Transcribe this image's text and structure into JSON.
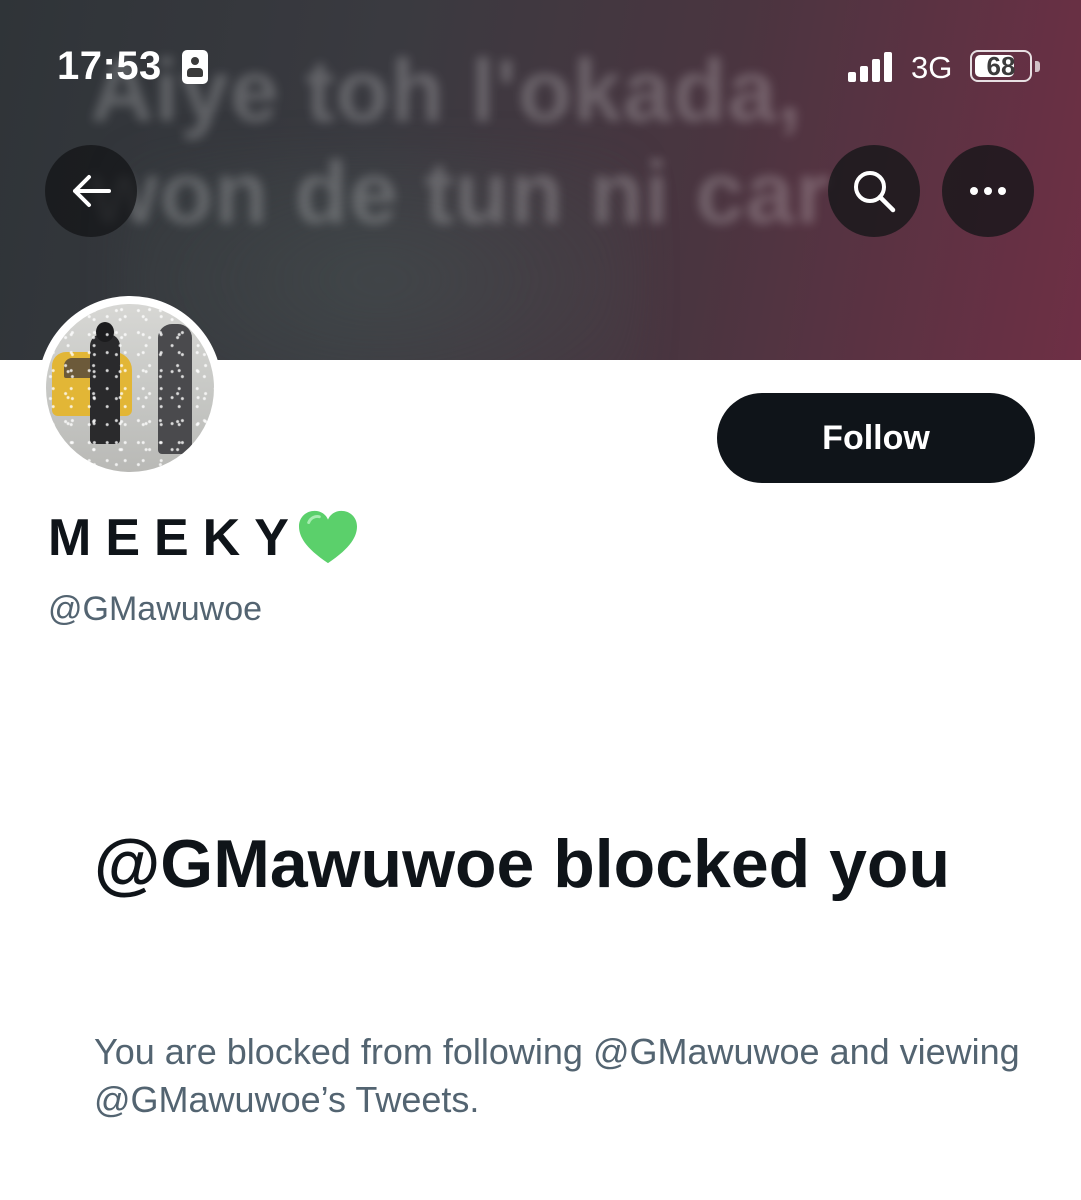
{
  "status_bar": {
    "time": "17:53",
    "network": "3G",
    "battery": "68"
  },
  "header": {
    "banner_text": "Aiye toh l'okada,\nwon de tun ni car",
    "back_icon": "back-arrow-icon",
    "search_icon": "search-icon",
    "more_icon": "more-options-icon"
  },
  "profile": {
    "display_name": "MEEKY",
    "handle": "@GMawuwoe",
    "follow_label": "Follow",
    "heart_color": "#5bd06b"
  },
  "blocked_notice": {
    "title": "@GMawuwoe blocked you",
    "description": "You are blocked from following @GMawuwoe and viewing @GMawuwoe’s Tweets."
  }
}
